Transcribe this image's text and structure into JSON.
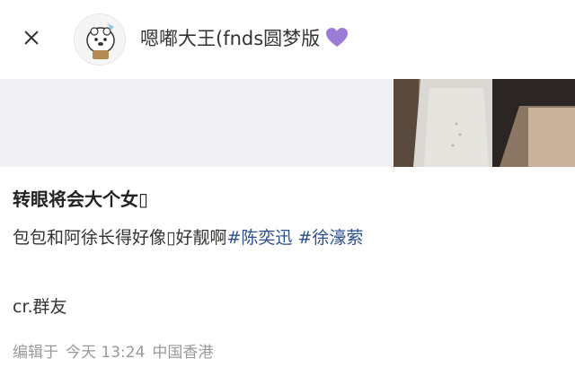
{
  "header": {
    "author_name": "嗯嘟大王(fnds圆梦版"
  },
  "post": {
    "title": "转眼将会大个女▯",
    "body_text": "包包和阿徐长得好像▯好靓啊",
    "tags": [
      "#陈奕迅",
      "#徐濠萦"
    ],
    "credit": "cr.群友"
  },
  "meta": {
    "edit_label": "编辑于",
    "time": "今天 13:24",
    "location": "中国香港"
  },
  "colors": {
    "tag": "#2b4f8f",
    "heart": "#9b7bd6",
    "meta": "#999999"
  }
}
